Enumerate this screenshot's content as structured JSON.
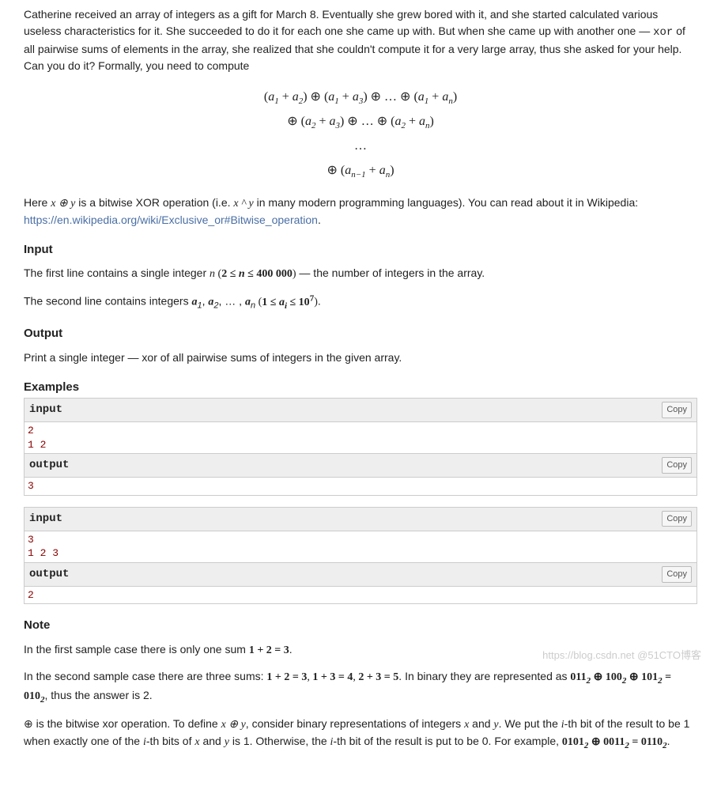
{
  "intro": {
    "p1a": "Catherine received an array of integers as a gift for March 8. Eventually she grew bored with it, and she started calculated various useless characteristics for it. She succeeded to do it for each one she came up with. But when she came up with another one — ",
    "p1code": "xor",
    "p1b": " of all pairwise sums of elements in the array, she realized that she couldn't compute it for a very large array, thus she asked for your help. Can you do it? Formally, you need to compute"
  },
  "formula": {
    "line1": "(a₁ + a₂) ⊕ (a₁ + a₃) ⊕ … ⊕ (a₁ + aₙ)",
    "line2": "⊕ (a₂ + a₃) ⊕ … ⊕ (a₂ + aₙ)",
    "line3": "…",
    "line4": "⊕ (aₙ₋₁ + aₙ)"
  },
  "xor_explain": {
    "a": "Here ",
    "expr1": "x ⊕ y",
    "b": " is a bitwise XOR operation (i.e. ",
    "expr2": "x ^ y",
    "c": " in many modern programming languages). You can read about it in Wikipedia: ",
    "link": "https://en.wikipedia.org/wiki/Exclusive_or#Bitwise_operation",
    "d": "."
  },
  "sections": {
    "input": "Input",
    "output": "Output",
    "examples": "Examples",
    "note": "Note"
  },
  "input_desc": {
    "p1a": "The first line contains a single integer ",
    "n": "n",
    "p1range": " (2 ≤ n ≤ 400 000)",
    "p1b": " — the number of integers in the array.",
    "p2a": "The second line contains integers ",
    "arr": "a₁, a₂, … , aₙ",
    "p2range": " (1 ≤ aᵢ ≤ 10⁷)",
    "p2b": "."
  },
  "output_desc": "Print a single integer — xor of all pairwise sums of integers in the given array.",
  "labels": {
    "input": "input",
    "output": "output",
    "copy": "Copy"
  },
  "ex1": {
    "in": "2\n1 2",
    "out": "3"
  },
  "ex2": {
    "in": "3\n1 2 3",
    "out": "2"
  },
  "note": {
    "p1a": "In the first sample case there is only one sum ",
    "p1math": "1 + 2 = 3",
    "p1b": ".",
    "p2a": "In the second sample case there are three sums: ",
    "p2math1": "1 + 2 = 3, 1 + 3 = 4, 2 + 3 = 5",
    "p2b": ". In binary they are represented as ",
    "p2math2": "011₂ ⊕ 100₂ ⊕ 101₂ = 010₂",
    "p2c": ", thus the answer is 2.",
    "p3a": "⊕ is the bitwise xor operation. To define ",
    "p3m1": "x ⊕ y",
    "p3b": ", consider binary representations of integers ",
    "p3x": "x",
    "p3and": " and ",
    "p3y": "y",
    "p3c": ". We put the ",
    "p3i1": "i",
    "p3d": "-th bit of the result to be 1 when exactly one of the ",
    "p3i2": "i",
    "p3e": "-th bits of ",
    "p3x2": "x",
    "p3and2": " and ",
    "p3y2": "y",
    "p3f": " is 1. Otherwise, the ",
    "p3i3": "i",
    "p3g": "-th bit of the result is put to be 0. For example, ",
    "p3m2": "0101₂ ⊕ 0011₂ = 0110₂",
    "p3h": "."
  },
  "watermark": "https://blog.csdn.net  @51CTO博客"
}
